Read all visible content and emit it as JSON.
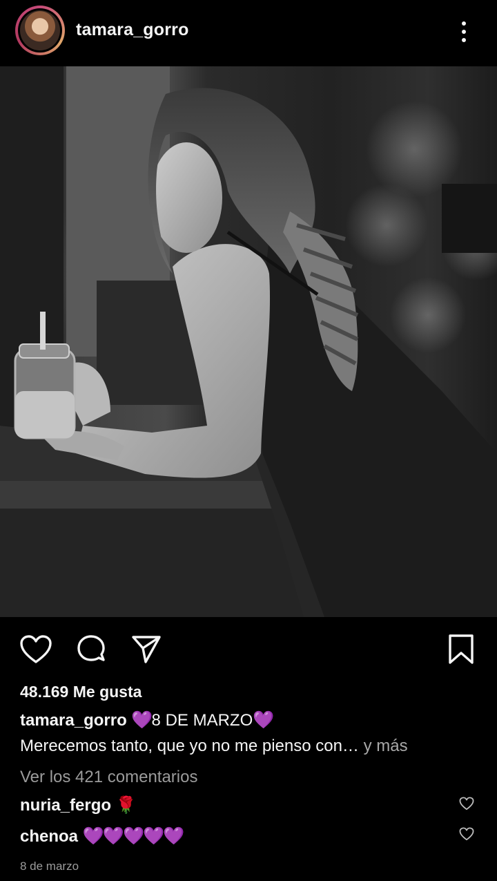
{
  "header": {
    "username": "tamara_gorro",
    "avatar_icon": "profile-photo",
    "menu_icon": "more-vertical-icon"
  },
  "actions": {
    "like_icon": "heart-outline-icon",
    "comment_icon": "comment-bubble-icon",
    "share_icon": "paper-plane-icon",
    "save_icon": "bookmark-outline-icon"
  },
  "post": {
    "likes_text": "48.169 Me gusta",
    "caption_user": "tamara_gorro",
    "caption_heart_left": "💜",
    "caption_title": "8 DE MARZO",
    "caption_heart_right": "💜",
    "caption_text": "Merecemos tanto, que yo no me pienso con…",
    "more_label": " y más",
    "view_comments": "Ver los 421 comentarios",
    "date": "8 de marzo"
  },
  "comments": [
    {
      "user": "nuria_fergo",
      "text": "🌹"
    },
    {
      "user": "chenoa",
      "text": "💜💜💜💜💜"
    }
  ],
  "colors": {
    "background": "#000000",
    "text": "#f5f5f5",
    "muted": "#9b9b9b",
    "purple_heart": "#8e35c9"
  }
}
